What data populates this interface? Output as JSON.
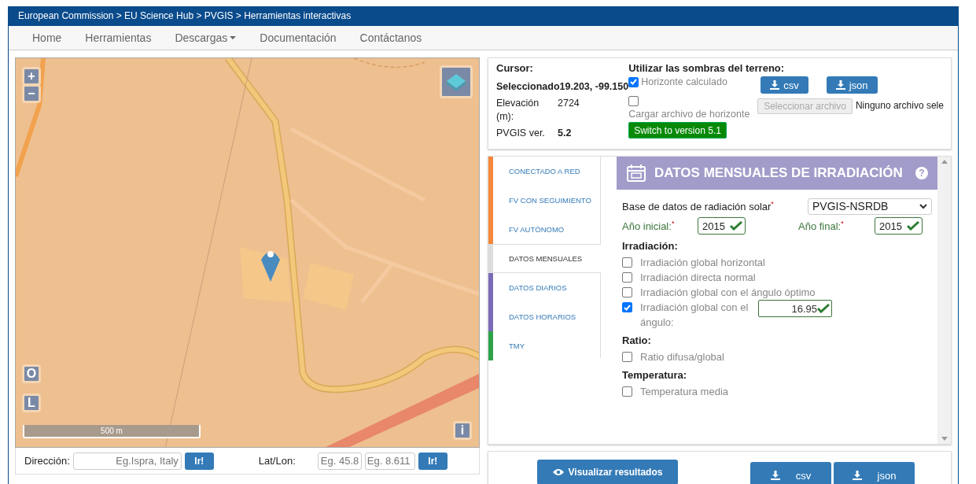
{
  "breadcrumb": "European Commission > EU Science Hub > PVGIS > Herramientas interactivas",
  "nav": [
    {
      "label": "Home",
      "has_menu": false
    },
    {
      "label": "Herramientas",
      "has_menu": false
    },
    {
      "label": "Descargas",
      "has_menu": true
    },
    {
      "label": "Documentación",
      "has_menu": false
    },
    {
      "label": "Contáctanos",
      "has_menu": false
    }
  ],
  "map": {
    "kind": "picture",
    "zoom_in": "+",
    "zoom_out": "−",
    "base_buttons": [
      "O",
      "L"
    ],
    "info": "i",
    "scale": "500 m"
  },
  "search": {
    "address_label": "Dirección:",
    "address_placeholder": "Eg.Ispra, Italy",
    "address_go": "Ir!",
    "latlon_label": "Lat/Lon:",
    "lat_placeholder": "Eg. 45.8",
    "lon_placeholder": "Eg. 8.611",
    "latlon_go": "Ir!"
  },
  "cursor": {
    "title": "Cursor:",
    "rows": [
      {
        "label": "Seleccionado",
        "value": "19.203, -99.150",
        "bold_label": true,
        "bold_value": true
      },
      {
        "label": "Elevación (m):",
        "value": "2724",
        "bold_label": false,
        "bold_value": false
      },
      {
        "label": "PVGIS ver.",
        "value": "5.2",
        "bold_label": false,
        "bold_value": true
      }
    ]
  },
  "horizon": {
    "title": "Utilizar las sombras del terreno:",
    "calculated": {
      "label": "Horizonte calculado",
      "checked": true
    },
    "upload": {
      "label": "Cargar archivo de horizonte",
      "checked": false
    },
    "downloads": [
      "csv",
      "json"
    ],
    "file_button": "Seleccionar archivo",
    "file_status": "Ninguno archivo sele",
    "switch_button": "Switch to version 5.1"
  },
  "tabs": [
    {
      "label": "CONECTADO A RED",
      "color": "#f5883a",
      "selected": false
    },
    {
      "label": "FV CON SEGUIMIENTO",
      "color": "#f5883a",
      "selected": false
    },
    {
      "label": "FV AUTÓNOMO",
      "color": "#f5883a",
      "selected": false
    },
    {
      "label": "DATOS MENSUALES",
      "color": "#dddddd",
      "selected": true
    },
    {
      "label": "DATOS DIARIOS",
      "color": "#7b6bb8",
      "selected": false
    },
    {
      "label": "DATOS HORARIOS",
      "color": "#7b6bb8",
      "selected": false
    },
    {
      "label": "TMY",
      "color": "#2ea24a",
      "selected": false
    }
  ],
  "panel": {
    "title": "DATOS MENSUALES DE IRRADIACIÓN",
    "help": "?",
    "database_label": "Base de datos de radiación solar$^{*}$",
    "database_value": "PVGIS-NSRDB",
    "start_label": "Año inicial:$^{*}$",
    "start_value": "2015",
    "end_label": "Año final:$^{*}$",
    "end_value": "2015",
    "sections": [
      {
        "title": "Irradiación:",
        "options": [
          {
            "label": "Irradiación global horizontal",
            "checked": false
          },
          {
            "label": "Irradiación directa normal",
            "checked": false
          },
          {
            "label": "Irradiación global con el ángulo óptimo",
            "checked": false
          },
          {
            "label": "Irradiación global con el ángulo:",
            "checked": true,
            "value": "16.95"
          }
        ]
      },
      {
        "title": "Ratio:",
        "options": [
          {
            "label": "Ratio difusa/global",
            "checked": false
          }
        ]
      },
      {
        "title": "Temperatura:",
        "options": [
          {
            "label": "Temperatura media",
            "checked": false
          }
        ]
      }
    ]
  },
  "actions": {
    "visualize": "Visualizar resultados",
    "downloads": [
      "csv",
      "json"
    ]
  }
}
